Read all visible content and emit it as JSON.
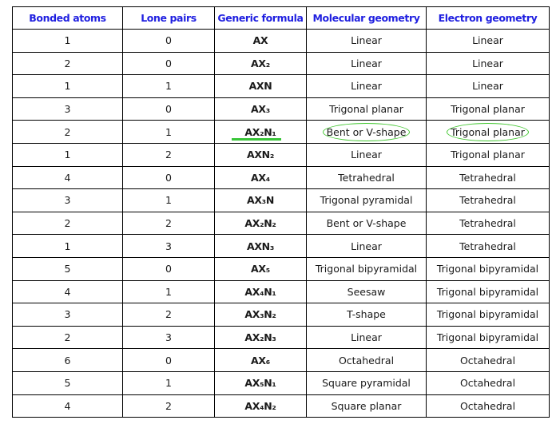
{
  "table": {
    "headers": [
      "Bonded atoms",
      "Lone pairs",
      "Generic formula",
      "Molecular geometry",
      "Electron geometry"
    ],
    "rows": [
      {
        "bonded": "1",
        "lone": "0",
        "formula": "AX",
        "molecular": "Linear",
        "electron": "Linear"
      },
      {
        "bonded": "2",
        "lone": "0",
        "formula": "AX₂",
        "molecular": "Linear",
        "electron": "Linear"
      },
      {
        "bonded": "1",
        "lone": "1",
        "formula": "AXN",
        "molecular": "Linear",
        "electron": "Linear"
      },
      {
        "bonded": "3",
        "lone": "0",
        "formula": "AX₃",
        "molecular": "Trigonal planar",
        "electron": "Trigonal planar"
      },
      {
        "bonded": "2",
        "lone": "1",
        "formula": "AX₂N₁",
        "molecular": "Bent or V-shape",
        "electron": "Trigonal planar",
        "highlighted": true
      },
      {
        "bonded": "1",
        "lone": "2",
        "formula": "AXN₂",
        "molecular": "Linear",
        "electron": "Trigonal planar"
      },
      {
        "bonded": "4",
        "lone": "0",
        "formula": "AX₄",
        "molecular": "Tetrahedral",
        "electron": "Tetrahedral"
      },
      {
        "bonded": "3",
        "lone": "1",
        "formula": "AX₃N",
        "molecular": "Trigonal pyramidal",
        "electron": "Tetrahedral"
      },
      {
        "bonded": "2",
        "lone": "2",
        "formula": "AX₂N₂",
        "molecular": "Bent or V-shape",
        "electron": "Tetrahedral"
      },
      {
        "bonded": "1",
        "lone": "3",
        "formula": "AXN₃",
        "molecular": "Linear",
        "electron": "Tetrahedral"
      },
      {
        "bonded": "5",
        "lone": "0",
        "formula": "AX₅",
        "molecular": "Trigonal bipyramidal",
        "electron": "Trigonal bipyramidal"
      },
      {
        "bonded": "4",
        "lone": "1",
        "formula": "AX₄N₁",
        "molecular": "Seesaw",
        "electron": "Trigonal bipyramidal"
      },
      {
        "bonded": "3",
        "lone": "2",
        "formula": "AX₃N₂",
        "molecular": "T-shape",
        "electron": "Trigonal bipyramidal"
      },
      {
        "bonded": "2",
        "lone": "3",
        "formula": "AX₂N₃",
        "molecular": "Linear",
        "electron": "Trigonal bipyramidal"
      },
      {
        "bonded": "6",
        "lone": "0",
        "formula": "AX₆",
        "molecular": "Octahedral",
        "electron": "Octahedral"
      },
      {
        "bonded": "5",
        "lone": "1",
        "formula": "AX₅N₁",
        "molecular": "Square pyramidal",
        "electron": "Octahedral"
      },
      {
        "bonded": "4",
        "lone": "2",
        "formula": "AX₄N₂",
        "molecular": "Square planar",
        "electron": "Octahedral"
      }
    ]
  },
  "colors": {
    "header_text": "#1f1fe0",
    "formula_text": "#ee1b1b",
    "highlight": "#44c832"
  }
}
